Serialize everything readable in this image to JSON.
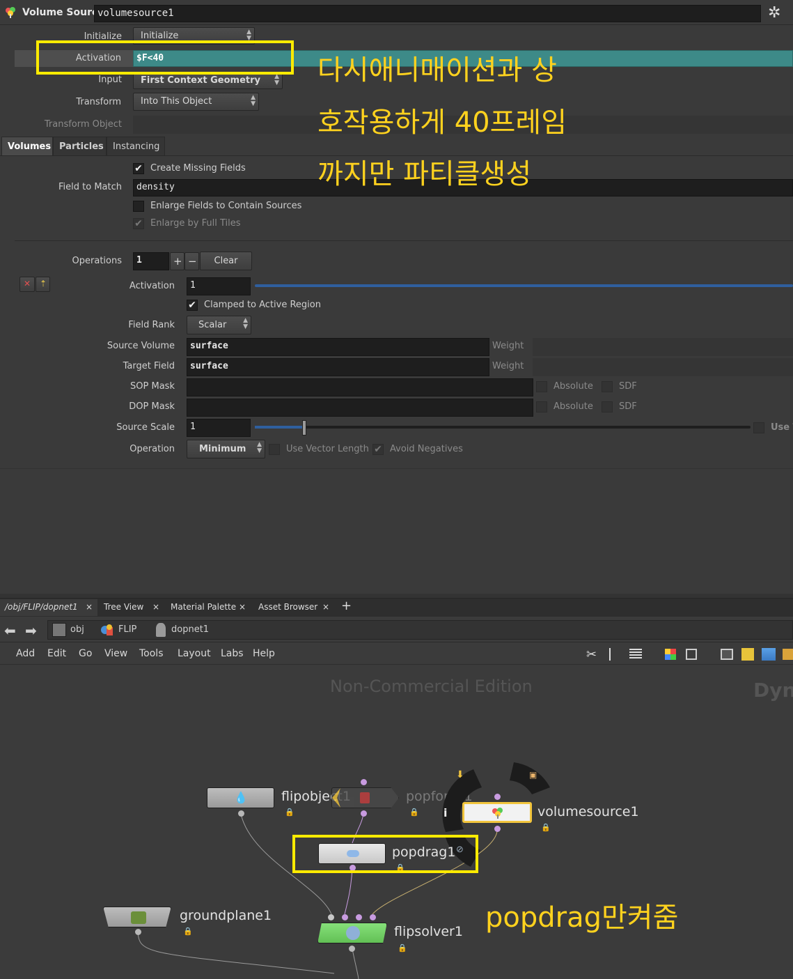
{
  "header": {
    "node_type": "Volume Source",
    "node_name": "volumesource1"
  },
  "params": {
    "initialize_label": "Initialize",
    "initialize_value": "Initialize",
    "activation_label": "Activation",
    "activation_value": "$F<40",
    "input_label": "Input",
    "input_value": "First Context Geometry",
    "transform_label": "Transform",
    "transform_value": "Into This Object",
    "transform_object_label": "Transform Object"
  },
  "tabs": [
    "Volumes",
    "Particles",
    "Instancing"
  ],
  "volumes": {
    "create_missing": "Create Missing Fields",
    "field_to_match_label": "Field to Match",
    "field_to_match_value": "density",
    "enlarge": "Enlarge Fields to Contain Sources",
    "enlarge_full": "Enlarge by Full Tiles",
    "operations_label": "Operations",
    "operations_value": "1",
    "plus": "+",
    "minus": "−",
    "clear": "Clear"
  },
  "op": {
    "x_icon": "✕",
    "move_icon": "⇡",
    "activation_label": "Activation",
    "activation_value": "1",
    "clamped": "Clamped to Active Region",
    "field_rank_label": "Field Rank",
    "field_rank_value": "Scalar",
    "source_volume_label": "Source Volume",
    "source_volume_value": "surface",
    "target_field_label": "Target Field",
    "target_field_value": "surface",
    "weight": "Weight",
    "sop_mask_label": "SOP Mask",
    "dop_mask_label": "DOP Mask",
    "absolute": "Absolute",
    "sdf": "SDF",
    "source_scale_label": "Source Scale",
    "source_scale_value": "1",
    "use_t": "Use T",
    "operation_label": "Operation",
    "operation_value": "Minimum",
    "use_vector_length": "Use Vector Length",
    "avoid_negatives": "Avoid Negatives"
  },
  "annotations": {
    "line1": "다시애니매이션과 상",
    "line2": "호작용하게 40프레임",
    "line3": "까지만 파티클생성",
    "popdrag_note": "popdrag만켜줌"
  },
  "pane_tabs": [
    "/obj/FLIP/dopnet1",
    "Tree View",
    "Material Palette",
    "Asset Browser"
  ],
  "breadcrumb": [
    "obj",
    "FLIP",
    "dopnet1"
  ],
  "menu": [
    "Add",
    "Edit",
    "Go",
    "View",
    "Tools",
    "Layout",
    "Labs",
    "Help"
  ],
  "network": {
    "watermark": "Non-Commercial Edition",
    "context_label": "Dyn",
    "nodes": {
      "flipobject": "flipobject1",
      "popforce": "popforce1",
      "volumesource": "volumesource1",
      "popdrag": "popdrag1",
      "groundplane": "groundplane1",
      "flipsolver": "flipsolver1"
    }
  },
  "colors": {
    "accent_teal": "#3d8a88",
    "annotation_yellow": "#ffeb00",
    "solver_green": "#7ed46e"
  }
}
